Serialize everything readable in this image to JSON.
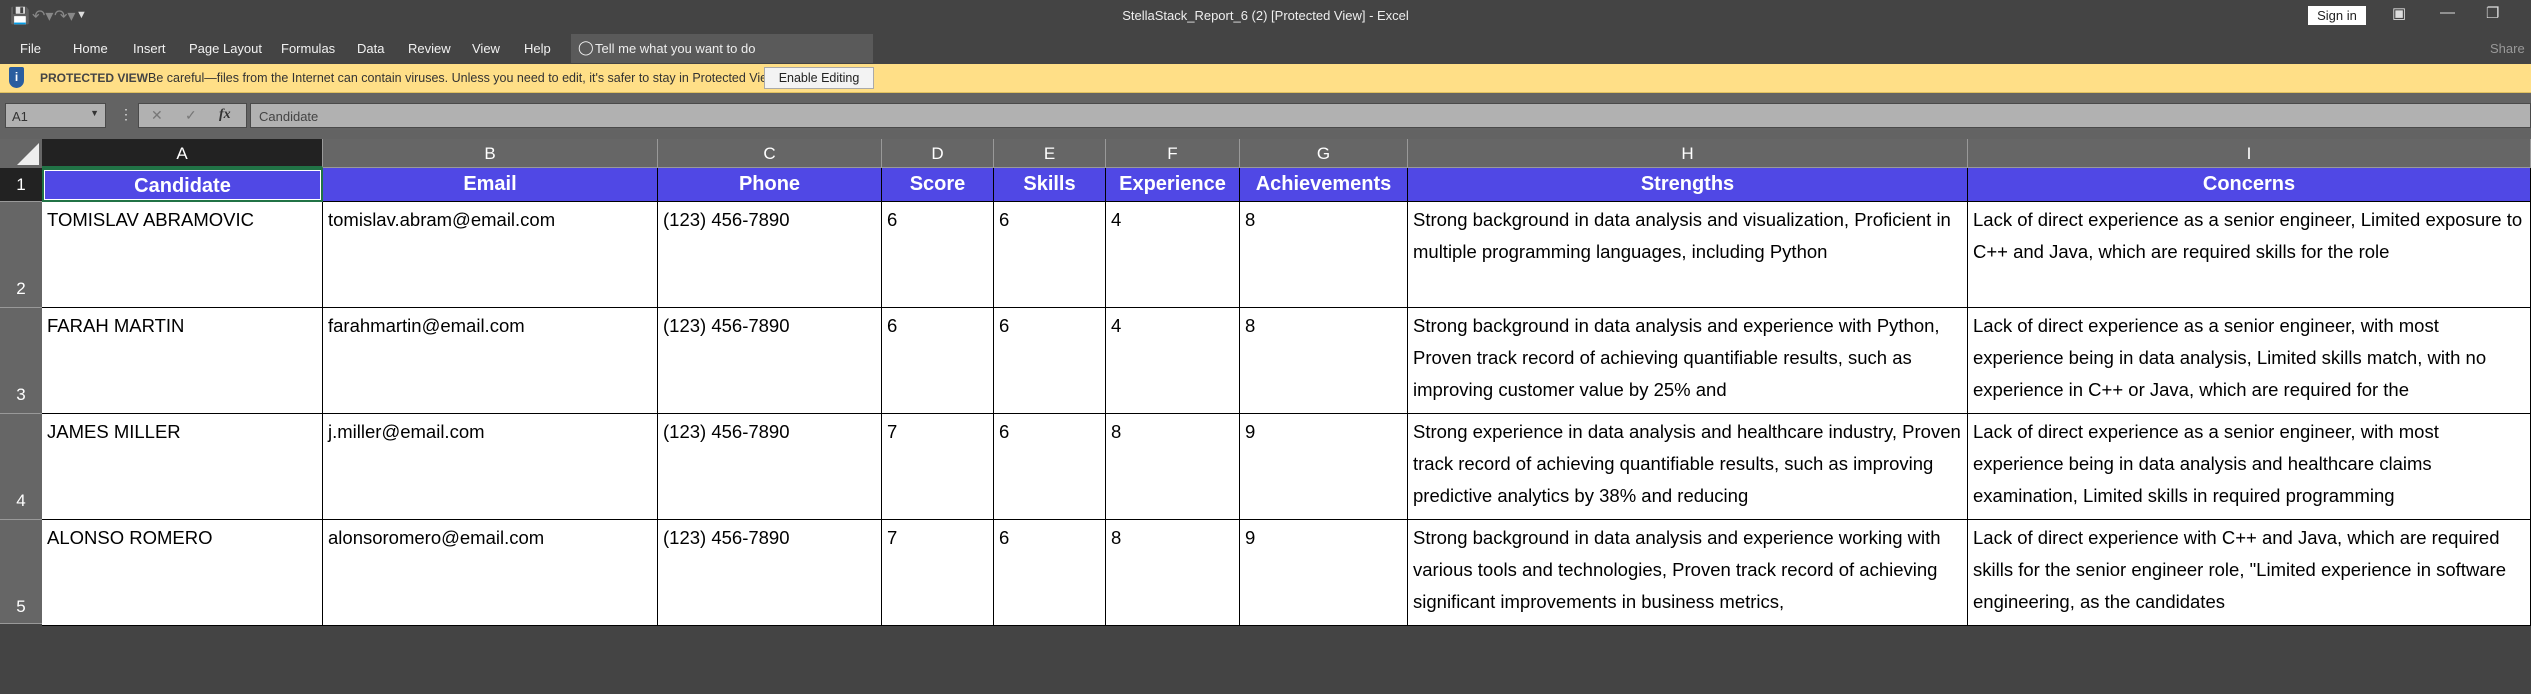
{
  "window": {
    "title": "StellaStack_Report_6 (2)  [Protected View]  -  Excel",
    "sign_in": "Sign in",
    "share": "Share"
  },
  "ribbon": {
    "tabs": [
      "File",
      "Home",
      "Insert",
      "Page Layout",
      "Formulas",
      "Data",
      "Review",
      "View",
      "Help"
    ],
    "tell_me": "Tell me what you want to do"
  },
  "protected_view": {
    "label": "PROTECTED VIEW",
    "message": "Be careful—files from the Internet can contain viruses. Unless you need to edit, it's safer to stay in Protected View.",
    "button": "Enable Editing"
  },
  "formula_bar": {
    "name_box": "A1",
    "cancel": "✕",
    "enter": "✓",
    "fx": "fx",
    "value": "Candidate"
  },
  "sheet": {
    "columns": [
      "A",
      "B",
      "C",
      "D",
      "E",
      "F",
      "G",
      "H",
      "I"
    ],
    "row_numbers": [
      "1",
      "2",
      "3",
      "4",
      "5"
    ],
    "selected_cell": "A1",
    "header_fill": "#5048E5",
    "headers": [
      "Candidate",
      "Email",
      "Phone",
      "Score",
      "Skills",
      "Experience",
      "Achievements",
      "Strengths",
      "Concerns"
    ],
    "rows": [
      [
        "TOMISLAV ABRAMOVIC",
        "tomislav.abram@email.com",
        "(123) 456-7890",
        "6",
        "6",
        "4",
        "8",
        "Strong background in data analysis and visualization, Proficient in multiple programming languages, including Python",
        "Lack of direct experience as a senior engineer, Limited exposure to C++ and Java, which are required skills for the role"
      ],
      [
        "FARAH MARTIN",
        "farahmartin@email.com",
        "(123) 456-7890",
        "6",
        "6",
        "4",
        "8",
        "Strong background in data analysis and experience with Python, Proven track record of achieving quantifiable results, such as improving customer value by 25% and",
        "Lack of direct experience as a senior engineer, with most experience being in data analysis, Limited skills match, with no experience in C++ or Java, which are required for the"
      ],
      [
        "JAMES MILLER",
        "j.miller@email.com",
        "(123) 456-7890",
        "7",
        "6",
        "8",
        "9",
        "Strong experience in data analysis and healthcare industry, Proven track record of achieving quantifiable results, such as improving predictive analytics by 38% and reducing",
        "Lack of direct experience as a senior engineer, with most experience being in data analysis and healthcare claims examination, Limited skills in required programming"
      ],
      [
        "ALONSO ROMERO",
        "alonsoromero@email.com",
        "(123) 456-7890",
        "7",
        "6",
        "8",
        "9",
        "Strong background in data analysis and experience working with various tools and technologies, Proven track record of achieving significant improvements in business metrics,",
        "Lack of direct experience with C++ and Java, which are required skills for the senior engineer role, \"Limited experience in software engineering, as the candidates"
      ]
    ]
  }
}
